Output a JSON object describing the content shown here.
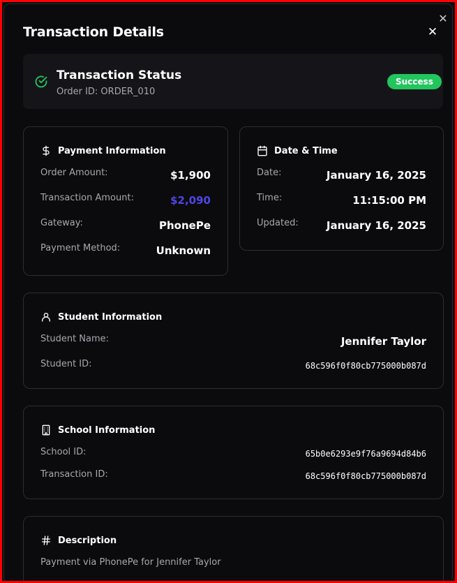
{
  "dialog": {
    "title": "Transaction Details",
    "close_icon": "close-icon"
  },
  "status": {
    "title": "Transaction Status",
    "order_id": "Order ID: ORDER_010",
    "badge": "Success",
    "icon": "check-circle-icon",
    "badge_color": "#22c55e"
  },
  "payment": {
    "heading": "Payment Information",
    "icon": "dollar-icon",
    "rows": [
      {
        "label": "Order Amount:",
        "value": "$1,900"
      },
      {
        "label": "Transaction Amount:",
        "value": "$2,090"
      },
      {
        "label": "Gateway:",
        "value": "PhonePe"
      },
      {
        "label": "Payment Method:",
        "value": "Unknown"
      }
    ],
    "accent_color": "#4f46e5"
  },
  "datetime": {
    "heading": "Date & Time",
    "icon": "calendar-icon",
    "rows": [
      {
        "label": "Date:",
        "value": "January 16, 2025"
      },
      {
        "label": "Time:",
        "value": "11:15:00 PM"
      },
      {
        "label": "Updated:",
        "value": "January 16, 2025"
      }
    ]
  },
  "student": {
    "heading": "Student Information",
    "icon": "user-icon",
    "rows": [
      {
        "label": "Student Name:",
        "value": "Jennifer Taylor"
      },
      {
        "label": "Student ID:",
        "value": "68c596f0f80cb775000b087d"
      }
    ]
  },
  "school": {
    "heading": "School Information",
    "icon": "building-icon",
    "rows": [
      {
        "label": "School ID:",
        "value": "65b0e6293e9f76a9694d84b6"
      },
      {
        "label": "Transaction ID:",
        "value": "68c596f0f80cb775000b087d"
      }
    ]
  },
  "description": {
    "heading": "Description",
    "icon": "hash-icon",
    "text": "Payment via PhonePe for Jennifer Taylor"
  }
}
